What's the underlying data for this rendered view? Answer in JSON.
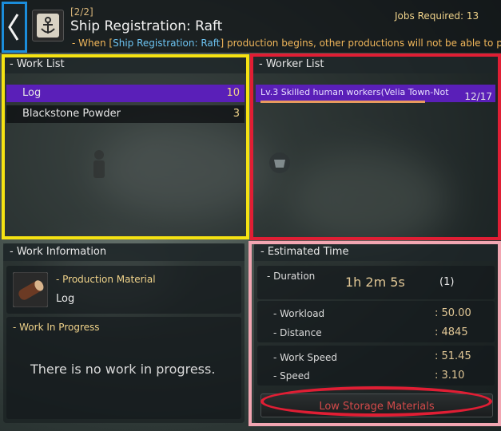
{
  "header": {
    "step": "[2/2]",
    "title": "Ship Registration: Raft",
    "jobs_required_label": "Jobs Required: 13",
    "notice_prefix": "- When [",
    "notice_highlight": "Ship Registration: Raft",
    "notice_suffix": "] production begins, other productions will not be able to pro"
  },
  "work_list": {
    "title": "- Work List",
    "items": [
      {
        "name": "Log",
        "qty": "10",
        "selected": true
      },
      {
        "name": "Blackstone Powder",
        "qty": "3",
        "selected": false
      }
    ]
  },
  "worker_list": {
    "title": "- Worker List",
    "worker": "Lv.3 Skilled human workers(Velia Town-Not",
    "stamina": "12/17"
  },
  "work_info": {
    "title": "- Work Information",
    "production_material_label": "- Production Material",
    "material_name": "Log",
    "in_progress_label": "- Work In Progress",
    "empty_message": "There is no work in progress."
  },
  "estimated_time": {
    "title": "- Estimated Time",
    "duration_label": "- Duration",
    "duration_value": "1h 2m 5s",
    "duration_count": "(1)",
    "workload_label": "- Workload",
    "workload_value": ": 50.00",
    "distance_label": "- Distance",
    "distance_value": ": 4845",
    "work_speed_label": "- Work Speed",
    "work_speed_value": ": 51.45",
    "speed_label": "- Speed",
    "speed_value": ": 3.10",
    "button_label": "Low Storage Materials"
  },
  "colors": {
    "selected_row": "#5a1fb8",
    "highlight_blue": "#1b8ddb",
    "highlight_yellow": "#f5e212",
    "highlight_red": "#e01e34",
    "highlight_pink": "#f2a6b2",
    "notice_text": "#f0b65a",
    "notice_link": "#6cc2f0"
  },
  "icons": [
    "back-arrow-icon",
    "ship-anchor-icon",
    "log-material-icon",
    "worker-figure-icon",
    "worker-face-icon"
  ]
}
